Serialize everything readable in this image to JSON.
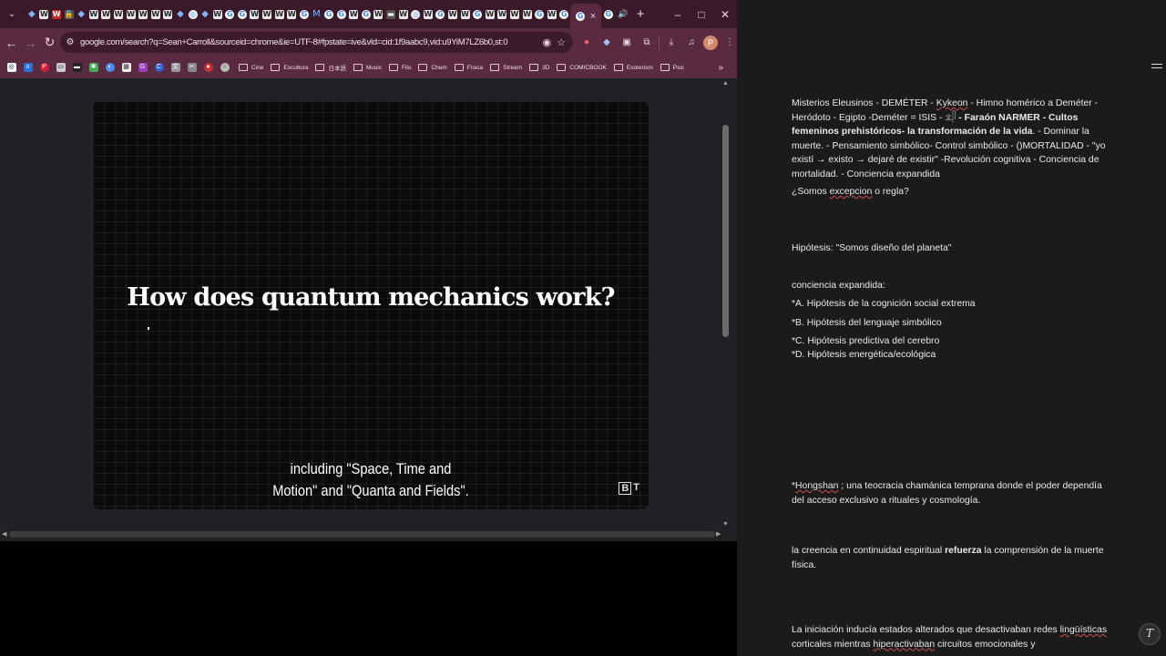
{
  "browser": {
    "tabs": {
      "favicons": [
        "pin",
        "w",
        "w-red",
        "lock",
        "pin",
        "w",
        "w",
        "w",
        "w",
        "w",
        "w",
        "w",
        "pin",
        "circle",
        "pin",
        "w",
        "g",
        "g",
        "w",
        "w",
        "w",
        "w",
        "g",
        "m",
        "g",
        "g",
        "w",
        "g",
        "w",
        "doc",
        "w",
        "circle",
        "w",
        "g",
        "w",
        "w",
        "g",
        "w",
        "w",
        "w",
        "w",
        "g",
        "w",
        "g"
      ],
      "active_favicon": "g",
      "active_close": "×",
      "media_icon": "speaker-icon",
      "new_tab": "+"
    },
    "window": {
      "minimize": "–",
      "maximize": "□",
      "close": "✕"
    },
    "url": "google.com/search?q=Sean+Carroll&sourceid=chrome&ie=UTF-8#fpstate=ive&vld=cid:1f9aabc9,vid:u9YiM7LZ6b0,st:0",
    "bookmark_folders": [
      "Cine",
      "Escultura",
      "日本語",
      "Music",
      "Filo",
      "Chem",
      "Física",
      "Stream",
      "3D",
      "COMICBOOK",
      "Esoterism",
      "Psic"
    ],
    "video": {
      "title": "How does quantum mechanics work?",
      "caption_line1": "including \"Space, Time and",
      "caption_line2": "Motion\" and \"Quanta and Fields\".",
      "logo_b": "B",
      "logo_t": "T"
    }
  },
  "notes": {
    "p1_a": "Misterios Eleusinos - DEMÉTER - ",
    "p1_kykeon": "Kykeon",
    "p1_b": "  - Himno homérico a Deméter - Heródoto - Egipto -Deméter = ISIS - ",
    "p1_glyph": "𓁷𓋴",
    "p1_bold": " - Faraón NARMER - Cultos femeninos prehistóricos- la transformación de la vida",
    "p1_c": ". - Dominar la muerte. - Pensamiento simbólico- Control simbólico - ()MORTALIDAD - \"yo existí → existo → dejaré de existir\" -Revolución cognitiva - Conciencia de mortalidad. - Conciencia expandida",
    "q_a": "¿Somos ",
    "q_spell": "excepcion",
    "q_b": " o regla?",
    "hyp": "Hipótesis:  \"Somos diseño del planeta\"",
    "ce": "conciencia expandida:",
    "a": "*A. Hipótesis de la cognición social extrema",
    "b": "*B. Hipótesis del lenguaje simbólico",
    "c": "*C. Hipótesis predictiva del cerebro",
    "d": "*D. Hipótesis energética/ecológica",
    "hong_a": "*",
    "hong_spell": "Hongshan",
    "hong_b": " ; una teocracia chamánica temprana donde el poder dependía del acceso exclusivo a rituales y cosmología.",
    "cre_a": "la creencia en continuidad espiritual ",
    "cre_bold": "refuerza",
    "cre_b": " la comprensión de la muerte física.",
    "ini_a": "La iniciación inducía estados alterados que desactivaban redes ",
    "ini_spell1": "lingüísticas",
    "ini_b": " corticales mientras ",
    "ini_spell2": "hiperactivaban",
    "ini_c": " circuitos emocionales y"
  }
}
